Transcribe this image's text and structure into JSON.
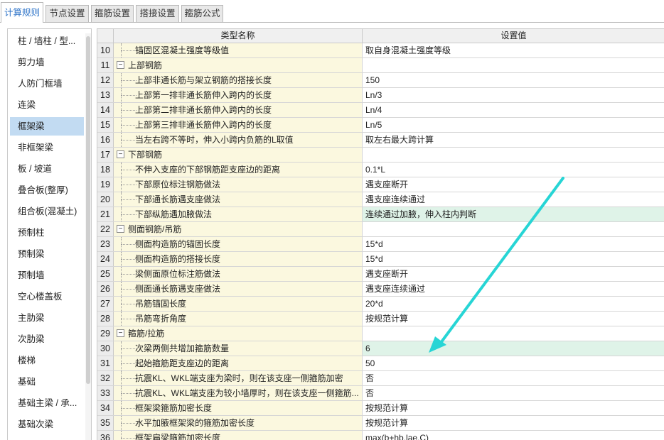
{
  "tabs": [
    {
      "label": "计算规则",
      "active": true
    },
    {
      "label": "节点设置",
      "active": false
    },
    {
      "label": "箍筋设置",
      "active": false
    },
    {
      "label": "搭接设置",
      "active": false
    },
    {
      "label": "箍筋公式",
      "active": false
    }
  ],
  "left_items": [
    "柱 / 墙柱 / 型...",
    "剪力墙",
    "人防门框墙",
    "连梁",
    "框架梁",
    "非框架梁",
    "板 / 坡道",
    "叠合板(整厚)",
    "组合板(混凝土)",
    "预制柱",
    "预制梁",
    "预制墙",
    "空心楼盖板",
    "主肋梁",
    "次肋梁",
    "楼梯",
    "基础",
    "基础主梁 / 承...",
    "基础次梁"
  ],
  "left_selected": "框架梁",
  "grid": {
    "header_name": "类型名称",
    "header_value": "设置值",
    "rows": [
      {
        "num": "10",
        "name": "锚固区混凝土强度等级值",
        "value": "取自身混凝土强度等级",
        "group": false,
        "hl": false
      },
      {
        "num": "11",
        "name": "上部钢筋",
        "value": "",
        "group": true,
        "hl": false
      },
      {
        "num": "12",
        "name": "上部非通长筋与架立钢筋的搭接长度",
        "value": "150",
        "group": false,
        "hl": false
      },
      {
        "num": "13",
        "name": "上部第一排非通长筋伸入跨内的长度",
        "value": "Ln/3",
        "group": false,
        "hl": false
      },
      {
        "num": "14",
        "name": "上部第二排非通长筋伸入跨内的长度",
        "value": "Ln/4",
        "group": false,
        "hl": false
      },
      {
        "num": "15",
        "name": "上部第三排非通长筋伸入跨内的长度",
        "value": "Ln/5",
        "group": false,
        "hl": false
      },
      {
        "num": "16",
        "name": "当左右跨不等时，伸入小跨内负筋的L取值",
        "value": "取左右最大跨计算",
        "group": false,
        "hl": false
      },
      {
        "num": "17",
        "name": "下部钢筋",
        "value": "",
        "group": true,
        "hl": false
      },
      {
        "num": "18",
        "name": "不伸入支座的下部钢筋距支座边的距离",
        "value": "0.1*L",
        "group": false,
        "hl": false
      },
      {
        "num": "19",
        "name": "下部原位标注钢筋做法",
        "value": "遇支座断开",
        "group": false,
        "hl": false
      },
      {
        "num": "20",
        "name": "下部通长筋遇支座做法",
        "value": "遇支座连续通过",
        "group": false,
        "hl": false
      },
      {
        "num": "21",
        "name": "下部纵筋遇加腋做法",
        "value": "连续通过加腋，伸入柱内判断",
        "group": false,
        "hl": true
      },
      {
        "num": "22",
        "name": "侧面钢筋/吊筋",
        "value": "",
        "group": true,
        "hl": false
      },
      {
        "num": "23",
        "name": "侧面构造筋的锚固长度",
        "value": "15*d",
        "group": false,
        "hl": false
      },
      {
        "num": "24",
        "name": "侧面构造筋的搭接长度",
        "value": "15*d",
        "group": false,
        "hl": false
      },
      {
        "num": "25",
        "name": "梁侧面原位标注筋做法",
        "value": "遇支座断开",
        "group": false,
        "hl": false
      },
      {
        "num": "26",
        "name": "侧面通长筋遇支座做法",
        "value": "遇支座连续通过",
        "group": false,
        "hl": false
      },
      {
        "num": "27",
        "name": "吊筋锚固长度",
        "value": "20*d",
        "group": false,
        "hl": false
      },
      {
        "num": "28",
        "name": "吊筋弯折角度",
        "value": "按规范计算",
        "group": false,
        "hl": false
      },
      {
        "num": "29",
        "name": "箍筋/拉筋",
        "value": "",
        "group": true,
        "hl": false
      },
      {
        "num": "30",
        "name": "次梁两侧共增加箍筋数量",
        "value": "6",
        "group": false,
        "hl": true
      },
      {
        "num": "31",
        "name": "起始箍筋距支座边的距离",
        "value": "50",
        "group": false,
        "hl": false
      },
      {
        "num": "32",
        "name": "抗震KL、WKL端支座为梁时，则在该支座一侧箍筋加密",
        "value": "否",
        "group": false,
        "hl": false
      },
      {
        "num": "33",
        "name": "抗震KL、WKL端支座为较小墙厚时，则在该支座一侧箍筋...",
        "value": "否",
        "group": false,
        "hl": false
      },
      {
        "num": "34",
        "name": "框架梁箍筋加密长度",
        "value": "按规范计算",
        "group": false,
        "hl": false
      },
      {
        "num": "35",
        "name": "水平加腋框架梁的箍筋加密长度",
        "value": "按规范计算",
        "group": false,
        "hl": false
      },
      {
        "num": "36",
        "name": "框架扁梁箍筋加密长度",
        "value": "max(b+hb,lae,C)",
        "group": false,
        "hl": false
      }
    ]
  },
  "colors": {
    "accent": "#2d73c8",
    "selected_bg": "#c2dbf2",
    "name_cell_bg": "#fbf8df",
    "highlight_row": "#dff3e8",
    "annotation_arrow": "#27d5d5"
  },
  "icons": {
    "group_toggle": "minus-box-icon",
    "annotation": "cyan-arrow-icon"
  }
}
